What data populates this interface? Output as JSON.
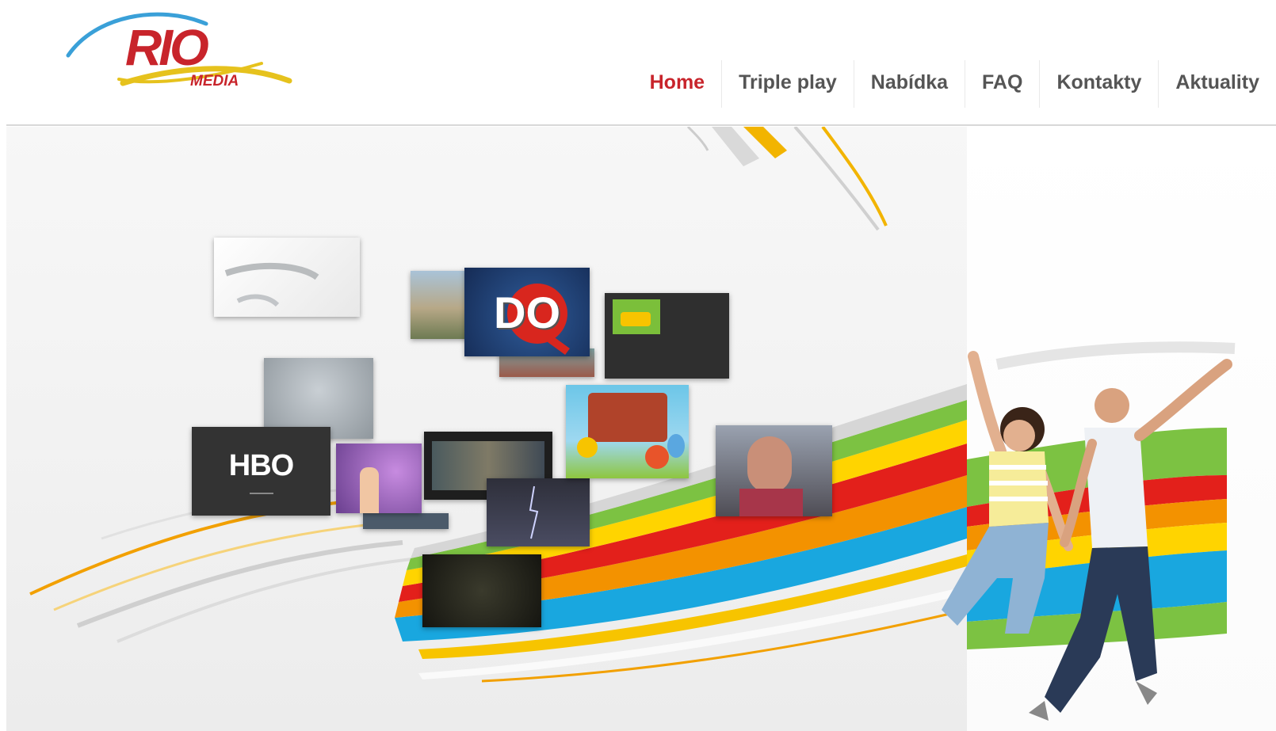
{
  "logo": {
    "brand": "RIO",
    "sub": "MEDIA"
  },
  "nav": {
    "items": [
      {
        "label": "Home",
        "active": true
      },
      {
        "label": "Triple play",
        "active": false
      },
      {
        "label": "Nabídka",
        "active": false
      },
      {
        "label": "FAQ",
        "active": false
      },
      {
        "label": "Kontakty",
        "active": false
      },
      {
        "label": "Aktuality",
        "active": false
      }
    ]
  },
  "banner": {
    "tiles": {
      "hbo": "HBO",
      "dq": "DO"
    }
  },
  "colors": {
    "accent": "#c8242b",
    "nav_text": "#555555",
    "logo_red": "#c8242b",
    "logo_yellow": "#e6c21d",
    "logo_blue": "#3aa0d8"
  }
}
